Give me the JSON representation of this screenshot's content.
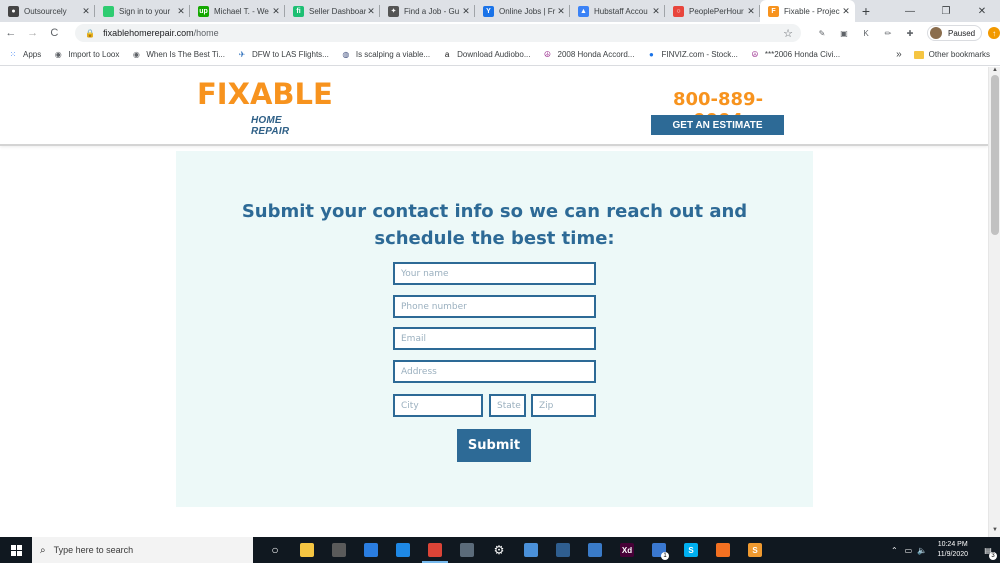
{
  "browser": {
    "tabs": [
      {
        "title": "Outsourcely",
        "favicon_color": "#444444",
        "favicon_glyph": "●"
      },
      {
        "title": "Sign in to your",
        "favicon_color": "#2ecc71",
        "favicon_glyph": ""
      },
      {
        "title": "Michael T. - We",
        "favicon_color": "#14a800",
        "favicon_glyph": "up"
      },
      {
        "title": "Seller Dashboar",
        "favicon_color": "#1dbf73",
        "favicon_glyph": "fi"
      },
      {
        "title": "Find a Job - Gu",
        "favicon_color": "#555555",
        "favicon_glyph": "✦"
      },
      {
        "title": "Online Jobs | Fr",
        "favicon_color": "#1a73e8",
        "favicon_glyph": "Y"
      },
      {
        "title": "Hubstaff Accou",
        "favicon_color": "#3b82f6",
        "favicon_glyph": "▲"
      },
      {
        "title": "PeoplePerHour",
        "favicon_color": "#e8453c",
        "favicon_glyph": "○"
      },
      {
        "title": "Fixable - Projec",
        "favicon_color": "#f7931e",
        "favicon_glyph": "F"
      }
    ],
    "active_tab_index": 8,
    "new_tab_glyph": "+",
    "window_controls": {
      "minimize": "—",
      "restore": "❐",
      "close": "✕"
    },
    "tab_close_glyph": "✕",
    "nav": {
      "back": "←",
      "forward": "→",
      "reload": "C"
    },
    "address": {
      "domain": "fixablehomerepair.com",
      "path": "/home",
      "lock_glyph": "🔒",
      "star_glyph": "☆"
    },
    "extensions": [
      "✎",
      "▣",
      "K",
      "✏",
      "✚"
    ],
    "profile_status": "Paused",
    "update_glyph": "↑"
  },
  "bookmarks": {
    "items": [
      {
        "label": "Apps",
        "icon": "apps-grid-icon",
        "color": "#4285f4"
      },
      {
        "label": "Import to Loox",
        "icon": "globe-icon",
        "color": "#5f6368"
      },
      {
        "label": "When Is The Best Ti...",
        "icon": "globe-icon",
        "color": "#5f6368"
      },
      {
        "label": "DFW to LAS Flights...",
        "icon": "plane-icon",
        "color": "#2a6ebb"
      },
      {
        "label": "Is scalping a viable...",
        "icon": "forum-icon",
        "color": "#3b4a7a"
      },
      {
        "label": "Download Audiobo...",
        "icon": "amazon-icon",
        "color": "#111111"
      },
      {
        "label": "2008 Honda Accord...",
        "icon": "peace-icon",
        "color": "#9b2d8e"
      },
      {
        "label": "FINVIZ.com - Stock...",
        "icon": "finviz-icon",
        "color": "#1a73e8"
      },
      {
        "label": "***2006 Honda Civi...",
        "icon": "peace-icon",
        "color": "#9b2d8e"
      }
    ],
    "overflow": "»",
    "other_bookmarks": "Other bookmarks"
  },
  "site": {
    "logo": {
      "word": "FIXABLE",
      "tagline": "HOME REPAIR"
    },
    "phone": "800-889-0004",
    "cta_label": "GET AN ESTIMATE",
    "colors": {
      "brand_orange": "#f7931e",
      "brand_blue": "#2d6a96",
      "panel_bg": "#edf9f8"
    }
  },
  "form": {
    "heading_line1": "Submit your contact info so we can reach out and",
    "heading_line2": "schedule the best time:",
    "name_placeholder": "Your name",
    "phone_placeholder": "Phone number",
    "email_placeholder": "Email",
    "address_placeholder": "Address",
    "city_placeholder": "City",
    "state_placeholder": "State",
    "zip_placeholder": "Zip",
    "submit_label": "Submit"
  },
  "taskbar": {
    "search_placeholder": "Type here to search",
    "apps": [
      {
        "name": "cortana-icon",
        "glyph": "○",
        "color": "transparent"
      },
      {
        "name": "file-explorer-icon",
        "glyph": "",
        "color": "#f5c542"
      },
      {
        "name": "store-icon",
        "glyph": "",
        "color": "#5a5a5a"
      },
      {
        "name": "safari-icon",
        "glyph": "",
        "color": "#2a7de1"
      },
      {
        "name": "edge-icon",
        "glyph": "",
        "color": "#1e88e5"
      },
      {
        "name": "chrome-icon",
        "glyph": "",
        "color": "#db4437"
      },
      {
        "name": "calculator-icon",
        "glyph": "",
        "color": "#5b6b7a"
      },
      {
        "name": "settings-icon",
        "glyph": "⚙",
        "color": "transparent"
      },
      {
        "name": "notepad-icon",
        "glyph": "",
        "color": "#4a90d9"
      },
      {
        "name": "media-icon",
        "glyph": "",
        "color": "#2f5e8f"
      },
      {
        "name": "photos-icon",
        "glyph": "",
        "color": "#3a7bc8"
      },
      {
        "name": "xd-icon",
        "glyph": "Xd",
        "color": "#470137"
      },
      {
        "name": "mail-icon",
        "glyph": "",
        "color": "#3a78d0"
      },
      {
        "name": "skype-icon",
        "glyph": "S",
        "color": "#00aff0"
      },
      {
        "name": "xampp-icon",
        "glyph": "",
        "color": "#f37021"
      },
      {
        "name": "sublime-icon",
        "glyph": "S",
        "color": "#f09a30"
      }
    ],
    "active_app_index": 5,
    "mail_badge": "1",
    "time": "10:24 PM",
    "date": "11/9/2020",
    "notification_count": "3"
  }
}
